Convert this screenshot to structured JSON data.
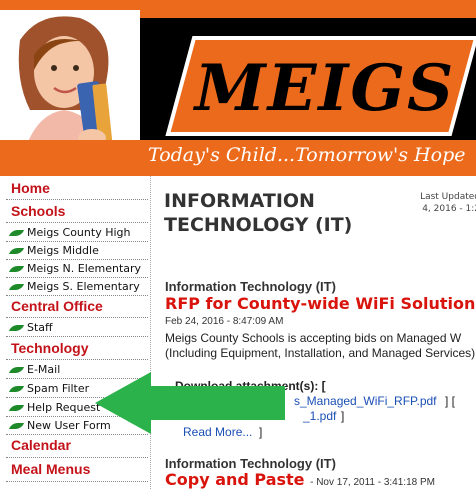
{
  "banner": {
    "logo_text": "MEIGS",
    "tagline": "Today's Child...Tomorrow's Hope",
    "colors": {
      "orange": "#ec6a1c",
      "black": "#000000"
    }
  },
  "sidebar": {
    "sections": [
      {
        "label": "Home"
      },
      {
        "label": "Schools",
        "items": [
          "Meigs County High",
          "Meigs Middle",
          "Meigs N. Elementary",
          "Meigs S. Elementary"
        ]
      },
      {
        "label": "Central Office",
        "items": [
          "Staff"
        ]
      },
      {
        "label": "Technology",
        "items": [
          "E-Mail",
          "Spam Filter",
          "Help Request",
          "New User Form"
        ]
      },
      {
        "label": "Calendar"
      },
      {
        "label": "Meal Menus"
      }
    ],
    "colors": {
      "heading": "#c31219",
      "leaf": "#1e8a2a"
    }
  },
  "main": {
    "page_title_line1": "INFORMATION",
    "page_title_line2": "TECHNOLOGY (IT)",
    "last_updated_line1": "Last Updated",
    "last_updated_line2": "4, 2016 - 1:2",
    "posts": [
      {
        "category": "Information Technology (IT)",
        "headline": "RFP for County-wide WiFi Solution",
        "date": "Feb 24, 2016 - 8:47:09 AM",
        "body": "Meigs County Schools is accepting bids on Managed W (Including Equipment, Installation, and Managed Services).",
        "attachment_label": "Download attachment(s): [",
        "attachment_1": "s_Managed_WiFi_RFP.pdf",
        "attachment_1_suffix": "] [",
        "attachment_2": "_1.pdf",
        "attachment_2_suffix": "]",
        "read_more": "Read More...",
        "read_more_suffix": "]"
      },
      {
        "category": "Information Technology (IT)",
        "headline": "Copy and Paste",
        "date": "- Nov 17, 2011 - 3:41:18 PM"
      }
    ],
    "colors": {
      "headline": "#d9140c",
      "link": "#1a4fb5"
    }
  },
  "overlay": {
    "arrow_color": "#2bb24a"
  }
}
